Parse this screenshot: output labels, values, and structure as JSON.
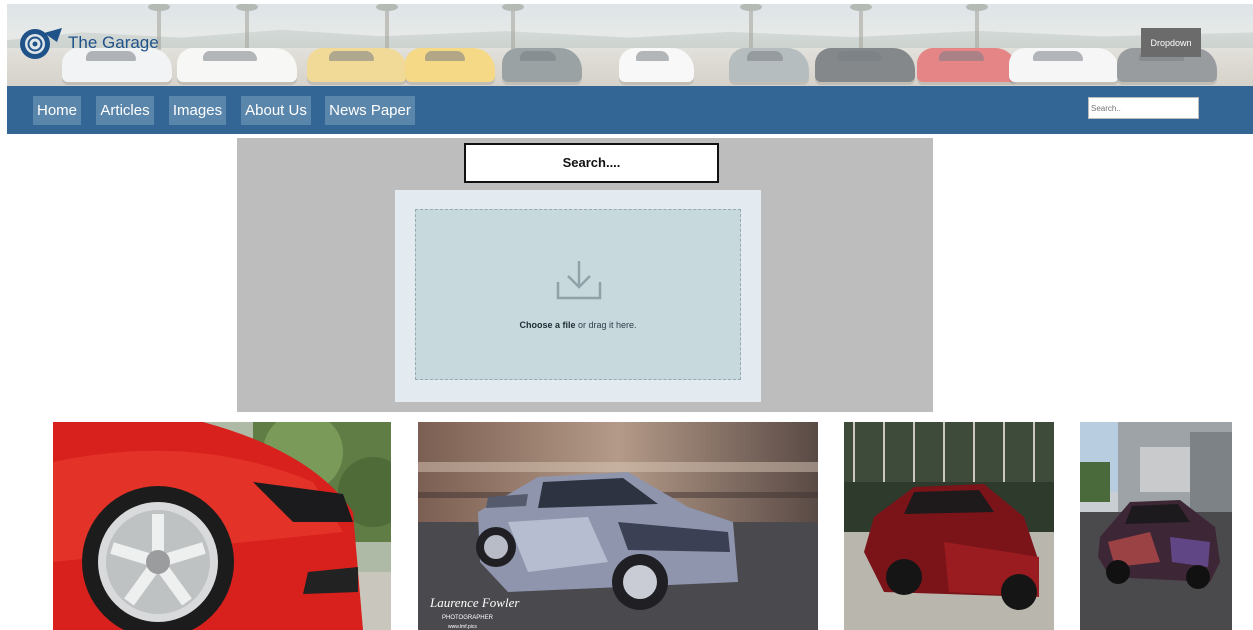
{
  "header": {
    "site_title": "The Garage",
    "dropdown_label": "Dropdown"
  },
  "nav": {
    "items": [
      {
        "label": "Home"
      },
      {
        "label": "Articles"
      },
      {
        "label": "Images"
      },
      {
        "label": "About Us"
      },
      {
        "label": "News Paper"
      }
    ],
    "search_placeholder": "Search.."
  },
  "upload": {
    "search_label": "Search....",
    "choose_file": "Choose a file",
    "drag_text": " or drag it here."
  },
  "gallery": {
    "images": [
      {
        "subject": "red-car-wheel-closeup"
      },
      {
        "subject": "ford-focus-rally-car",
        "watermark_name": "Laurence Fowler",
        "watermark_sub": "PHOTOGRAPHER",
        "watermark_url": "www.lmf.pics"
      },
      {
        "subject": "red-nissan-silvia"
      },
      {
        "subject": "nissan-350z-livery"
      }
    ]
  },
  "colors": {
    "nav_bg": "#336694",
    "nav_button": "#5b86ab",
    "title_blue": "#1f5289",
    "panel_bg": "#bdbdbd",
    "upload_bg": "#c8d9de"
  }
}
